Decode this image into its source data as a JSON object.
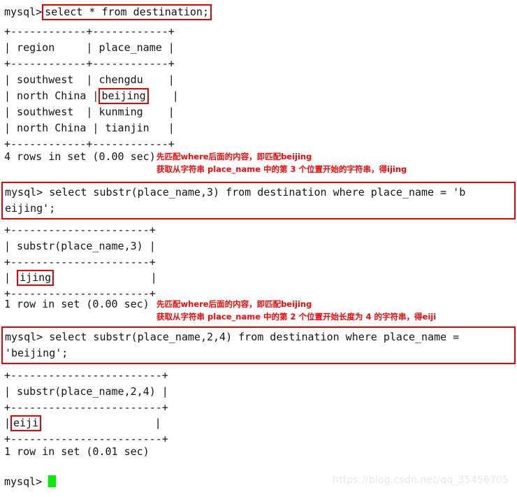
{
  "terminal": {
    "prompt": "mysql>",
    "block1": {
      "prompt_line_prompt": "mysql>",
      "command": "select * from destination;",
      "table": {
        "sep_top": "+------------+------------+",
        "header": "| region     | place_name |",
        "sep_mid": "+------------+------------+",
        "rows": [
          {
            "prefix": "| southwest  | ",
            "value": "chengdu",
            "suffix": "    |",
            "highlight": false
          },
          {
            "prefix": "| north China |",
            "value": "beijing",
            "suffix": "|",
            "highlight": true
          },
          {
            "prefix": "| southwest  | ",
            "value": "kunming",
            "suffix": "    |",
            "highlight": false
          },
          {
            "prefix": "| north China | ",
            "value": "tianjin",
            "suffix": "   |",
            "highlight": false
          }
        ],
        "sep_bottom": "+------------+------------+"
      },
      "status": "4 rows in set (0.00 sec)",
      "note_line1": "先匹配where后面的内容，即匹配beijing",
      "note_line2": "获取从字符串 place_name 中的第 3 个位置开始的字符串，得ijing"
    },
    "block2": {
      "sql_line1": "mysql> select substr(place_name,3) from destination where place_name = 'b",
      "sql_line2": "eijing';",
      "table": {
        "sep_top": "+----------------------+",
        "header": "| substr(place_name,3) |",
        "sep_mid": "+----------------------+",
        "row_prefix": "| ",
        "row_value": "ijing",
        "row_suffix": "              |",
        "sep_bottom": "+----------------------+"
      },
      "status": "1 row in set (0.00 sec)",
      "note_line1": "先匹配where后面的内容，即匹配beijing",
      "note_line2": "获取从字符串 place_name 中的第 2 个位置开始长度为 4 的字符串，得eiji"
    },
    "block3": {
      "sql_line1": "mysql> select substr(place_name,2,4) from destination where place_name =",
      "sql_line2": "'beijing';",
      "table": {
        "sep_top": "+------------------------+",
        "header": "| substr(place_name,2,4) |",
        "sep_mid": "+------------------------+",
        "row_prefix": "|",
        "row_value": "eiji",
        "row_suffix": "                 |",
        "sep_bottom": "+------------------------+"
      },
      "status": "1 row in set (0.01 sec)"
    },
    "final_prompt": "mysql>"
  },
  "watermark": "https://blog.csdn.net/qq_35456705",
  "colors": {
    "highlight_red": "#ee0000",
    "note_red": "#fa0505",
    "cursor_green": "#00ee00",
    "text": "#141414",
    "background": "#ffffff",
    "watermark": "#e8e8e8"
  }
}
